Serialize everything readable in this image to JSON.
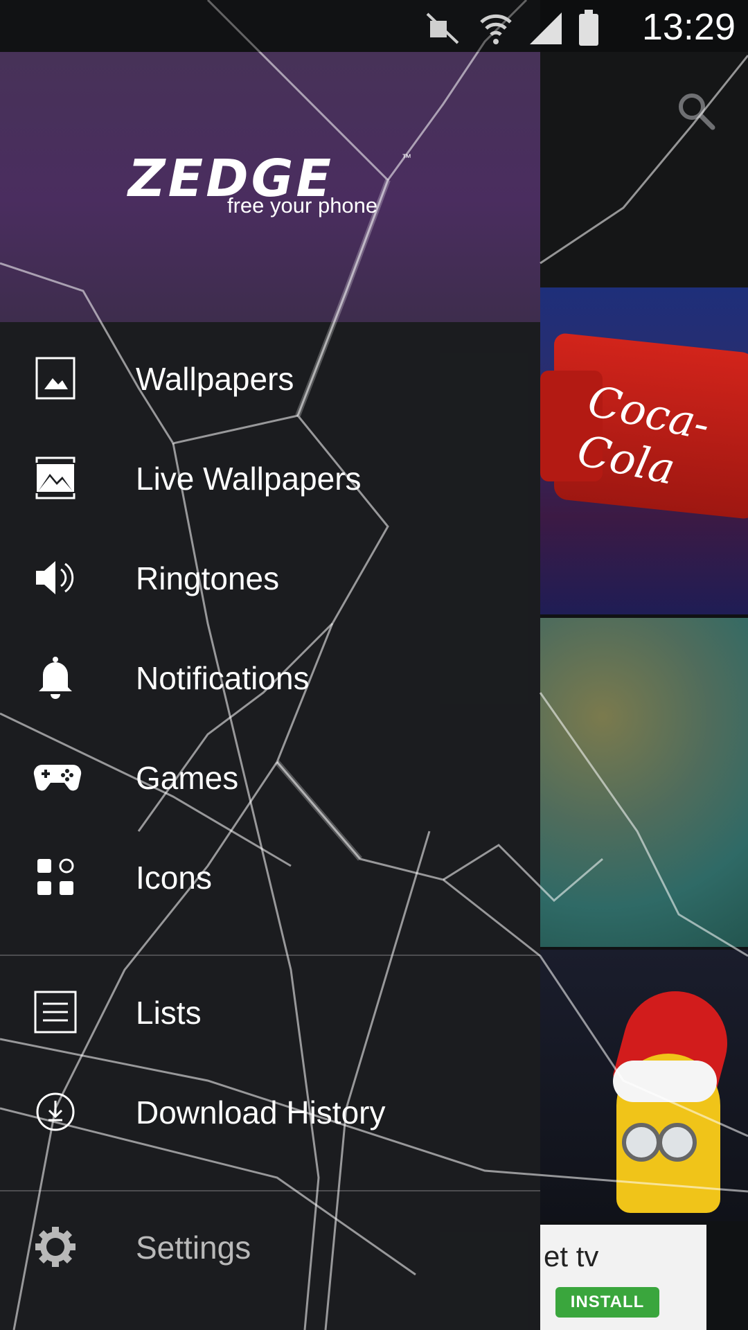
{
  "status_bar": {
    "time": "13:29",
    "icons": [
      "mute-icon",
      "wifi-icon",
      "signal-icon",
      "battery-icon"
    ]
  },
  "drawer": {
    "logo": {
      "wordmark": "ZEDGE",
      "trademark": "™",
      "tagline": "free your phone"
    },
    "items": [
      {
        "label": "Wallpapers",
        "icon": "image-icon"
      },
      {
        "label": "Live Wallpapers",
        "icon": "live-wallpaper-icon"
      },
      {
        "label": "Ringtones",
        "icon": "speaker-icon"
      },
      {
        "label": "Notifications",
        "icon": "bell-icon"
      },
      {
        "label": "Games",
        "icon": "gamepad-icon"
      },
      {
        "label": "Icons",
        "icon": "apps-grid-icon"
      }
    ],
    "secondary_items": [
      {
        "label": "Lists",
        "icon": "list-icon"
      },
      {
        "label": "Download History",
        "icon": "history-icon"
      }
    ],
    "settings": {
      "label": "Settings",
      "icon": "gear-icon"
    },
    "colors": {
      "header": "#4a2d5f",
      "drawer": "#1c1e21",
      "settings_text": "#b9b9b9"
    }
  },
  "background": {
    "tile1_text": "Coca-Cola",
    "ad": {
      "text": "et tv",
      "button": "INSTALL"
    }
  }
}
